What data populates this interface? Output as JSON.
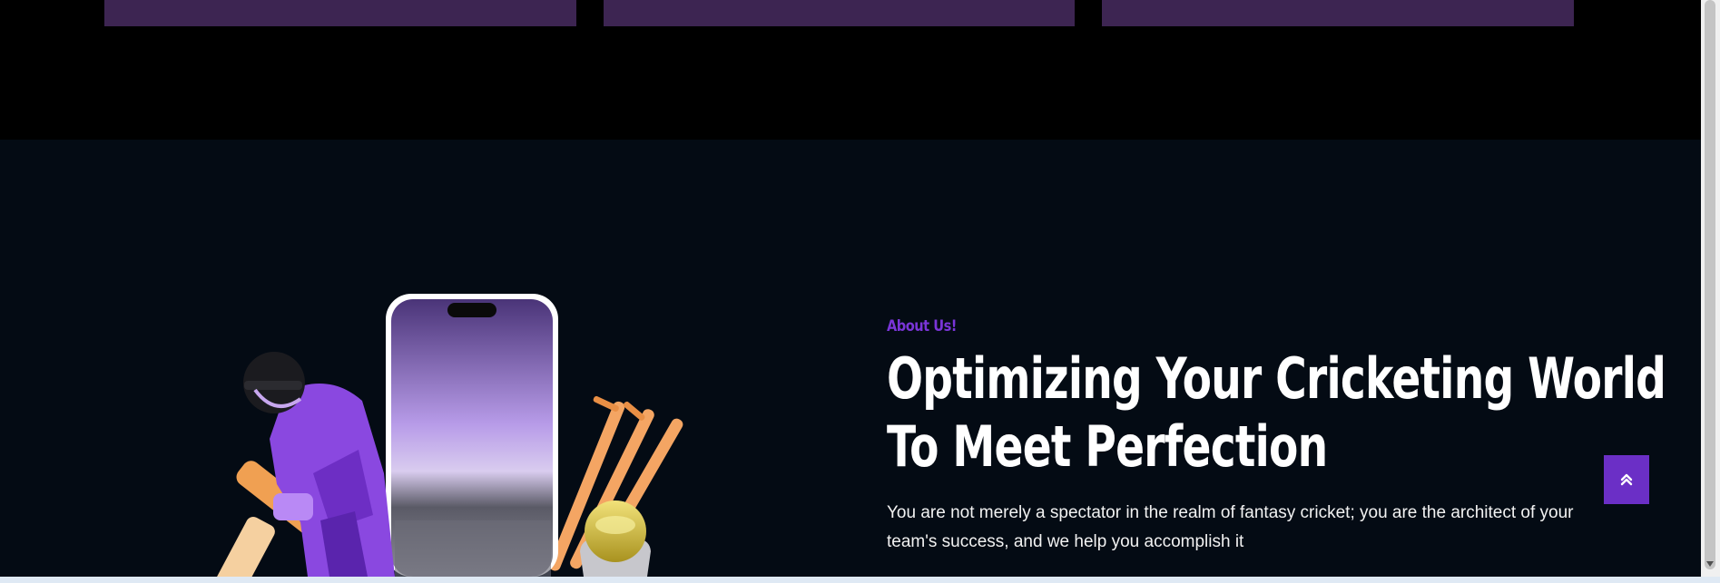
{
  "about": {
    "eyebrow": "About Us!",
    "heading_line1": "Optimizing Your Cricketing World",
    "heading_line2": "To Meet Perfection",
    "body": "You are not merely a spectator in the realm of fantasy cricket; you are the architect of your team's success, and we help you accomplish it"
  },
  "back_to_top": {
    "icon": "double-chevron-up-icon"
  },
  "colors": {
    "page_top": "#000000",
    "section_bg": "#040b14",
    "card": "#3d2552",
    "accent": "#6b2fc6",
    "eyebrow": "#7a35d8"
  }
}
